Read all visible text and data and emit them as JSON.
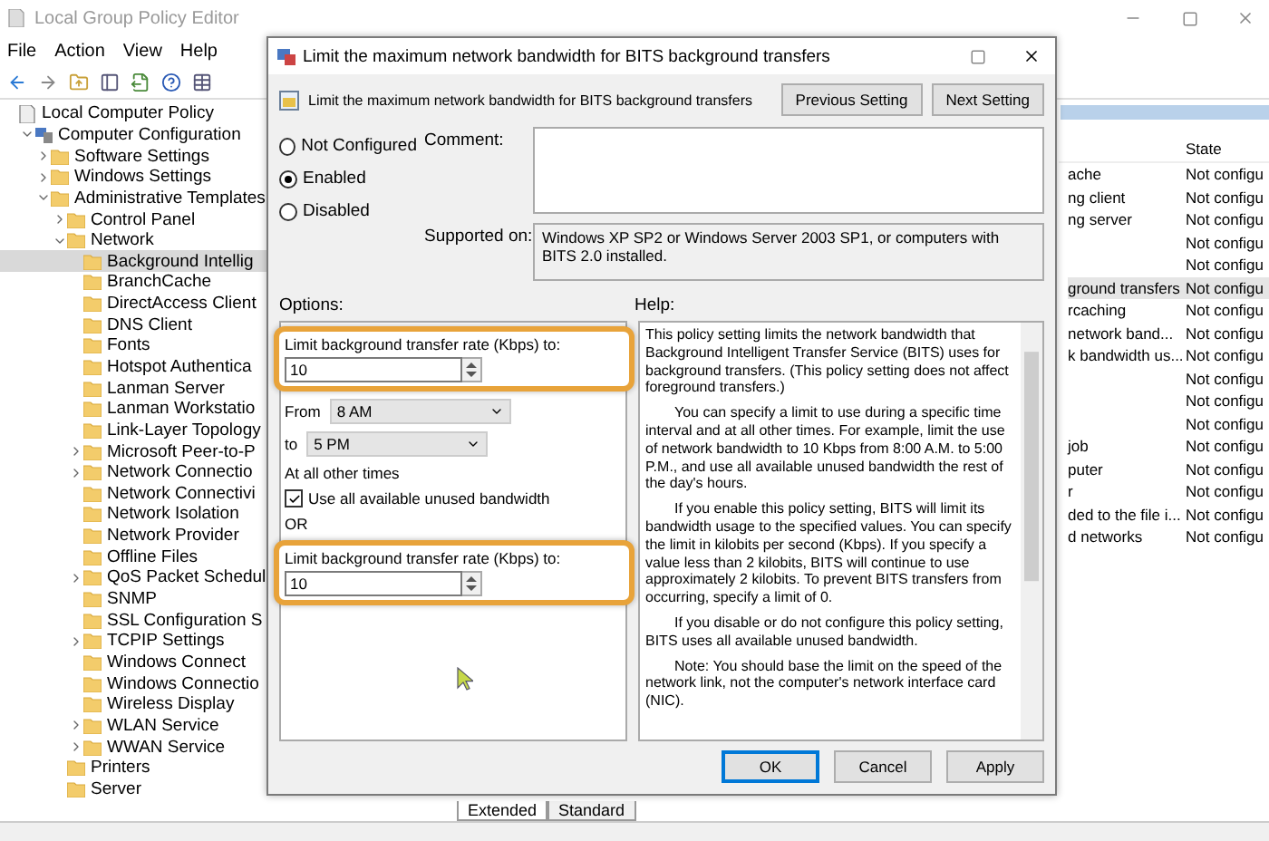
{
  "app": {
    "title": "Local Group Policy Editor",
    "menu": [
      "File",
      "Action",
      "View",
      "Help"
    ]
  },
  "tree": [
    {
      "label": "Local Computer Policy",
      "kind": "policy",
      "expandable": false,
      "selected": false,
      "children": [
        {
          "label": "Computer Configuration",
          "kind": "computer",
          "expandable": true,
          "expanded": true,
          "selected": false,
          "children": [
            {
              "label": "Software Settings",
              "kind": "folder",
              "expandable": true,
              "expanded": false,
              "selected": false
            },
            {
              "label": "Windows Settings",
              "kind": "folder",
              "expandable": true,
              "expanded": false,
              "selected": false
            },
            {
              "label": "Administrative Templates",
              "kind": "folder",
              "expandable": true,
              "expanded": true,
              "selected": false,
              "children": [
                {
                  "label": "Control Panel",
                  "kind": "folder",
                  "expandable": true,
                  "expanded": false,
                  "selected": false
                },
                {
                  "label": "Network",
                  "kind": "folder",
                  "expandable": true,
                  "expanded": true,
                  "selected": false,
                  "children": [
                    {
                      "label": "Background Intellig",
                      "kind": "folder",
                      "expandable": false,
                      "selected": true
                    },
                    {
                      "label": "BranchCache",
                      "kind": "folder",
                      "expandable": false,
                      "selected": false
                    },
                    {
                      "label": "DirectAccess Client",
                      "kind": "folder",
                      "expandable": false,
                      "selected": false
                    },
                    {
                      "label": "DNS Client",
                      "kind": "folder",
                      "expandable": false,
                      "selected": false
                    },
                    {
                      "label": "Fonts",
                      "kind": "folder",
                      "expandable": false,
                      "selected": false
                    },
                    {
                      "label": "Hotspot Authentica",
                      "kind": "folder",
                      "expandable": false,
                      "selected": false
                    },
                    {
                      "label": "Lanman Server",
                      "kind": "folder",
                      "expandable": false,
                      "selected": false
                    },
                    {
                      "label": "Lanman Workstatio",
                      "kind": "folder",
                      "expandable": false,
                      "selected": false
                    },
                    {
                      "label": "Link-Layer Topology",
                      "kind": "folder",
                      "expandable": false,
                      "selected": false
                    },
                    {
                      "label": "Microsoft Peer-to-P",
                      "kind": "folder",
                      "expandable": true,
                      "expanded": false,
                      "selected": false
                    },
                    {
                      "label": "Network Connectio",
                      "kind": "folder",
                      "expandable": true,
                      "expanded": false,
                      "selected": false
                    },
                    {
                      "label": "Network Connectivi",
                      "kind": "folder",
                      "expandable": false,
                      "selected": false
                    },
                    {
                      "label": "Network Isolation",
                      "kind": "folder",
                      "expandable": false,
                      "selected": false
                    },
                    {
                      "label": "Network Provider",
                      "kind": "folder",
                      "expandable": false,
                      "selected": false
                    },
                    {
                      "label": "Offline Files",
                      "kind": "folder",
                      "expandable": false,
                      "selected": false
                    },
                    {
                      "label": "QoS Packet Schedul",
                      "kind": "folder",
                      "expandable": true,
                      "expanded": false,
                      "selected": false
                    },
                    {
                      "label": "SNMP",
                      "kind": "folder",
                      "expandable": false,
                      "selected": false
                    },
                    {
                      "label": "SSL Configuration S",
                      "kind": "folder",
                      "expandable": false,
                      "selected": false
                    },
                    {
                      "label": "TCPIP Settings",
                      "kind": "folder",
                      "expandable": true,
                      "expanded": false,
                      "selected": false
                    },
                    {
                      "label": "Windows Connect",
                      "kind": "folder",
                      "expandable": false,
                      "selected": false
                    },
                    {
                      "label": "Windows Connectio",
                      "kind": "folder",
                      "expandable": false,
                      "selected": false
                    },
                    {
                      "label": "Wireless Display",
                      "kind": "folder",
                      "expandable": false,
                      "selected": false
                    },
                    {
                      "label": "WLAN Service",
                      "kind": "folder",
                      "expandable": true,
                      "expanded": false,
                      "selected": false
                    },
                    {
                      "label": "WWAN Service",
                      "kind": "folder",
                      "expandable": true,
                      "expanded": false,
                      "selected": false
                    }
                  ]
                },
                {
                  "label": "Printers",
                  "kind": "folder",
                  "expandable": false,
                  "selected": false
                },
                {
                  "label": "Server",
                  "kind": "folder",
                  "expandable": false,
                  "selected": false
                }
              ]
            }
          ]
        }
      ]
    }
  ],
  "list": {
    "state_header": "State",
    "rows": [
      {
        "name": "ache",
        "state": "Not configu",
        "selected": false
      },
      {
        "name": "ng client",
        "state": "Not configu",
        "selected": false
      },
      {
        "name": "ng server",
        "state": "Not configu",
        "selected": false
      },
      {
        "state": "Not configu",
        "selected": false
      },
      {
        "state": "Not configu",
        "selected": false
      },
      {
        "name": "ground transfers",
        "state": "Not configu",
        "selected": true
      },
      {
        "name": "rcaching",
        "state": "Not configu",
        "selected": false
      },
      {
        "name": "network band...",
        "state": "Not configu",
        "selected": false
      },
      {
        "name": "k bandwidth us...",
        "state": "Not configu",
        "selected": false
      },
      {
        "state": "Not configu",
        "selected": false
      },
      {
        "state": "Not configu",
        "selected": false
      },
      {
        "state": "Not configu",
        "selected": false
      },
      {
        "name": "job",
        "state": "Not configu",
        "selected": false
      },
      {
        "name": "puter",
        "state": "Not configu",
        "selected": false
      },
      {
        "name": "r",
        "state": "Not configu",
        "selected": false
      },
      {
        "name": "ded to the file i...",
        "state": "Not configu",
        "selected": false
      },
      {
        "name": "d networks",
        "state": "Not configu",
        "selected": false
      }
    ]
  },
  "view_tabs": [
    {
      "label": "Extended",
      "selected": true
    },
    {
      "label": "Standard",
      "selected": false
    }
  ],
  "dialog": {
    "title": "Limit the maximum network bandwidth for BITS background transfers",
    "heading": "Limit the maximum network bandwidth for BITS background transfers",
    "nav_buttons": [
      "Previous Setting",
      "Next Setting"
    ],
    "radios": [
      {
        "label": "Not Configured",
        "selected": false
      },
      {
        "label": "Enabled",
        "selected": true
      },
      {
        "label": "Disabled",
        "selected": false
      }
    ],
    "comment_label": "Comment:",
    "supported_label": "Supported on:",
    "supported_text": "Windows XP SP2 or Windows Server 2003 SP1, or computers with BITS 2.0 installed.",
    "options_label": "Options:",
    "help_label": "Help:",
    "options": {
      "limit_label": "Limit background transfer rate (Kbps) to:",
      "limit_value": "10",
      "from_label": "From",
      "from_value": "8 AM",
      "to_label": "to",
      "to_value": "5 PM",
      "other_label": "At all other times",
      "unused": {
        "label": "Use all available unused bandwidth",
        "checked": true
      },
      "or_label": "OR",
      "limit2_label": "Limit background transfer rate (Kbps) to:",
      "limit2_value": "10"
    },
    "help": [
      "This policy setting limits the network bandwidth that Background Intelligent Transfer Service (BITS) uses for background transfers. (This policy setting does not affect foreground transfers.)",
      "You can specify a limit to use during a specific time interval and at all other times. For example, limit the use of network bandwidth to 10 Kbps from 8:00 A.M. to 5:00 P.M., and use all available unused bandwidth the rest of the day's hours.",
      "If you enable this policy setting, BITS will limit its bandwidth usage to the specified values. You can specify the limit in kilobits per second (Kbps). If you specify a value less than 2 kilobits, BITS will continue to use approximately 2 kilobits. To prevent BITS transfers from occurring, specify a limit of 0.",
      "If you disable or do not configure this policy setting, BITS uses all available unused bandwidth.",
      "Note: You should base the limit on the speed of the network link, not the computer's network interface card (NIC)."
    ],
    "buttons": [
      {
        "label": "OK",
        "default": true
      },
      {
        "label": "Cancel",
        "default": false
      },
      {
        "label": "Apply",
        "default": false
      }
    ]
  }
}
